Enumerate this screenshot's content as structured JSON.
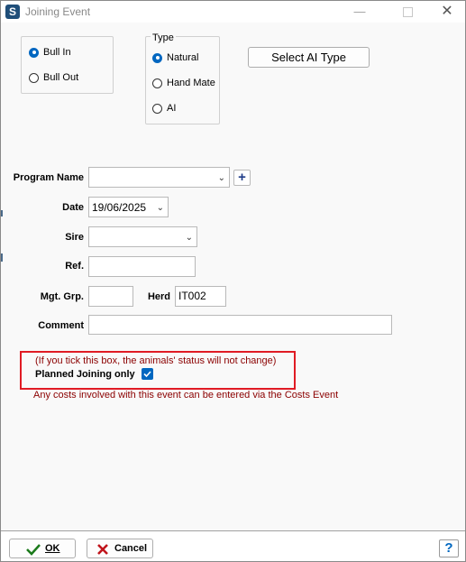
{
  "window": {
    "title": "Joining Event",
    "app_icon": "S"
  },
  "bull_group": {
    "options": [
      {
        "label": "Bull In",
        "mnemonic": "I",
        "checked": true
      },
      {
        "label": "Bull Out",
        "mnemonic": "O",
        "checked": false
      }
    ]
  },
  "type_group": {
    "title": "Type",
    "options": [
      {
        "label": "Natural",
        "mnemonic": "N",
        "checked": true
      },
      {
        "label": "Hand Mate",
        "mnemonic": "H",
        "checked": false
      },
      {
        "label": "AI",
        "mnemonic": "A",
        "checked": false
      }
    ]
  },
  "select_ai_button": "Select AI Type",
  "fields": {
    "program_name": {
      "label": "Program Name",
      "value": ""
    },
    "date": {
      "label": "Date",
      "value": "19/06/2025"
    },
    "sire": {
      "label": "Sire",
      "value": ""
    },
    "ref": {
      "label": "Ref.",
      "value": ""
    },
    "mgt_grp": {
      "label": "Mgt. Grp.",
      "value": ""
    },
    "herd": {
      "label": "Herd",
      "value": "IT002"
    },
    "comment": {
      "label": "Comment",
      "value": ""
    }
  },
  "planned": {
    "hint": "(If you tick this box, the animals' status will not change)",
    "label": "Planned Joining only",
    "checked": true
  },
  "costs_note": "Any costs involved with this event can be entered via the Costs Event",
  "footer": {
    "ok_label": "OK",
    "cancel_label": "Cancel",
    "help_label": "?"
  },
  "colors": {
    "accent": "#0067c0",
    "hint_text": "#8b0000",
    "highlight_box": "#e01b24"
  }
}
